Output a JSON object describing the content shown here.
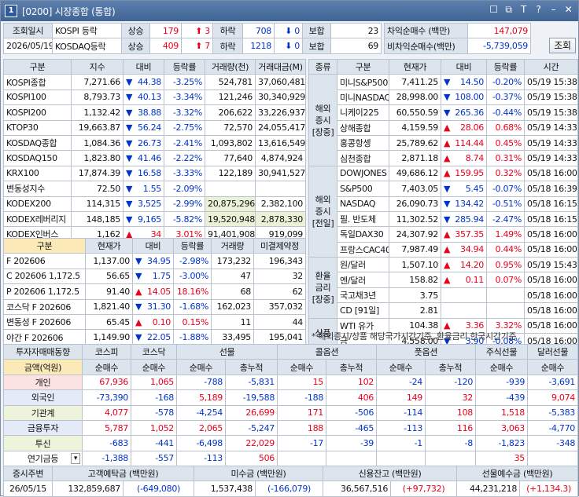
{
  "window": {
    "num": "1",
    "title": "[0200] 시장종합 (통합)",
    "btns": [
      "☐",
      "⧉",
      "T",
      "?",
      "–",
      "✕"
    ]
  },
  "top": {
    "inq_label": "조회일시",
    "date": "2026/05/19",
    "kospi": {
      "name": "KOSPI 등락",
      "up_lbl": "상승",
      "up": "179",
      "up_chg": "3",
      "dn_lbl": "하락",
      "dn": "708",
      "dn_chg": "0",
      "flat_lbl": "보합",
      "flat": "23"
    },
    "kosdaq": {
      "name": "KOSDAQ등락",
      "up_lbl": "상승",
      "up": "409",
      "up_chg": "7",
      "dn_lbl": "하락",
      "dn": "1218",
      "dn_chg": "0",
      "flat_lbl": "보합",
      "flat": "69"
    },
    "arb_label": "차익순매수",
    "arb_unit": "(백만)",
    "arb": "147,079",
    "narb_label": "비차익순매수",
    "narb_unit": "(백만)",
    "narb": "-5,739,059",
    "query_btn": "조회"
  },
  "index": {
    "headers": [
      "구분",
      "지수",
      "대비",
      "등락률",
      "거래량(천)",
      "거래대금(M)"
    ],
    "rows": [
      [
        "KOSPI종합",
        "7,271.66",
        "44.38",
        "-3.25%",
        "524,781",
        "37,060,481",
        "dn"
      ],
      [
        "KOSPI100",
        "8,793.73",
        "40.13",
        "-3.34%",
        "121,246",
        "30,340,929",
        "dn"
      ],
      [
        "KOSPI200",
        "1,132.42",
        "38.88",
        "-3.32%",
        "206,622",
        "33,226,937",
        "dn"
      ],
      [
        "KTOP30",
        "19,663.87",
        "56.24",
        "-2.75%",
        "72,570",
        "24,055,417",
        "dn"
      ],
      [
        "KOSDAQ종합",
        "1,084.36",
        "26.73",
        "-2.41%",
        "1,093,802",
        "13,616,549",
        "dn"
      ],
      [
        "KOSDAQ150",
        "1,823.80",
        "41.46",
        "-2.22%",
        "77,640",
        "4,874,924",
        "dn"
      ],
      [
        "KRX100",
        "17,874.39",
        "16.58",
        "-3.33%",
        "122,189",
        "30,941,527",
        "dn"
      ],
      [
        "변동성지수",
        "72.50",
        "1.55",
        "-2.09%",
        "",
        "",
        "dn"
      ],
      [
        "KODEX200",
        "114,315",
        "3,525",
        "-2.99%",
        "20,875,296",
        "2,382,100",
        "dn"
      ],
      [
        "KODEX레버리지",
        "148,185",
        "9,165",
        "-5.82%",
        "19,520,948",
        "2,878,330",
        "dn"
      ],
      [
        "KODEX인버스",
        "1,162",
        "34",
        "3.01%",
        "91,401,908",
        "919,099",
        "up"
      ]
    ]
  },
  "futures": {
    "headers": [
      "구분",
      "현재가",
      "대비",
      "등락률",
      "거래량",
      "미결제약정"
    ],
    "rows": [
      [
        "F 202606",
        "1,137.00",
        "34.95",
        "-2.98%",
        "173,232",
        "196,343",
        "dn"
      ],
      [
        "C 202606 1,172.5",
        "56.65",
        "1.75",
        "-3.00%",
        "47",
        "32",
        "dn"
      ],
      [
        "P 202606 1,172.5",
        "91.40",
        "14.05",
        "18.16%",
        "68",
        "62",
        "up"
      ],
      [
        "코스닥 F 202606",
        "1,821.40",
        "31.30",
        "-1.68%",
        "162,023",
        "357,032",
        "dn"
      ],
      [
        "변동성 F 202606",
        "65.45",
        "0.10",
        "0.15%",
        "11",
        "44",
        "up"
      ],
      [
        "야간 F 202606",
        "1,149.90",
        "22.05",
        "-1.88%",
        "33,495",
        "195,041",
        "dn"
      ]
    ]
  },
  "global": {
    "headers": [
      "종류",
      "구분",
      "현재가",
      "대비",
      "등락률",
      "시간"
    ],
    "groups": [
      {
        "label": "해외\n증시\n[장중]",
        "rows": [
          [
            "미니S&P500",
            "7,411.25",
            "14.50",
            "-0.20%",
            "05/19 15:38",
            "dn"
          ],
          [
            "미니NASDAQ",
            "28,998.00",
            "108.00",
            "-0.37%",
            "05/19 15:38",
            "dn"
          ],
          [
            "니케이225",
            "60,550.59",
            "265.36",
            "-0.44%",
            "05/19 15:38",
            "dn"
          ],
          [
            "상해종합",
            "4,159.59",
            "28.06",
            "0.68%",
            "05/19 14:33",
            "up"
          ],
          [
            "홍콩항셍",
            "25,789.62",
            "114.44",
            "0.45%",
            "05/19 14:33",
            "up"
          ],
          [
            "심천종합",
            "2,871.18",
            "8.74",
            "0.31%",
            "05/19 14:33",
            "up"
          ]
        ]
      },
      {
        "label": "해외\n증시\n[전일]",
        "rows": [
          [
            "DOWJONES",
            "49,686.12",
            "159.95",
            "0.32%",
            "05/18 16:00",
            "up"
          ],
          [
            "S&P500",
            "7,403.05",
            "5.45",
            "-0.07%",
            "05/18 16:39",
            "dn"
          ],
          [
            "NASDAQ",
            "26,090.73",
            "134.42",
            "-0.51%",
            "05/18 16:15",
            "dn"
          ],
          [
            "필. 반도체",
            "11,302.52",
            "285.94",
            "-2.47%",
            "05/18 16:15",
            "dn"
          ],
          [
            "독일DAX30",
            "24,307.92",
            "357.35",
            "1.49%",
            "05/18 16:00",
            "up"
          ],
          [
            "프랑스CAC40",
            "7,987.49",
            "34.94",
            "0.44%",
            "05/18 16:00",
            "up"
          ]
        ]
      },
      {
        "label": "환율\n금리\n[장중]",
        "rows": [
          [
            "원/달러",
            "1,507.10",
            "14.20",
            "0.95%",
            "05/19 15:43",
            "up"
          ],
          [
            "엔/달러",
            "158.82",
            "0.11",
            "0.07%",
            "05/18 16:00",
            "up"
          ],
          [
            "국고채3년",
            "3.75",
            "",
            "",
            "05/18 16:00",
            ""
          ],
          [
            "CD [91일]",
            "2.81",
            "",
            "",
            "05/18 16:00",
            ""
          ]
        ]
      },
      {
        "label": "상품",
        "rows": [
          [
            "WTI 유가",
            "104.38",
            "3.36",
            "3.32%",
            "05/18 16:00",
            "up"
          ],
          [
            "금",
            "4,558.00",
            "3.90",
            "-0.08%",
            "05/18 16:00",
            "dn"
          ]
        ]
      }
    ],
    "note": "* 해외증시/상품 해당국가시간기준, 환율금리 한국시간기준"
  },
  "investor": {
    "h1": [
      "투자자매매동향",
      "코스피",
      "코스닥",
      "선물",
      "",
      "콜옵션",
      "",
      "풋옵션",
      "",
      "주식선물",
      "달러선물"
    ],
    "h2": [
      "금액(억원)",
      "순매수",
      "순매수",
      "순매수",
      "총누적",
      "순매수",
      "총누적",
      "순매수",
      "총누적",
      "순매수",
      "순매수"
    ],
    "rows": [
      [
        "개인",
        "67,936",
        "1,065",
        "-788",
        "-5,831",
        "15",
        "102",
        "-24",
        "-120",
        "-939",
        "-3,691"
      ],
      [
        "외국인",
        "-73,390",
        "-168",
        "5,189",
        "-19,588",
        "-188",
        "406",
        "149",
        "32",
        "-439",
        "9,074"
      ],
      [
        "기관계",
        "4,077",
        "-578",
        "-4,254",
        "26,699",
        "171",
        "-506",
        "-114",
        "108",
        "1,518",
        "-5,383"
      ],
      [
        "금융투자",
        "5,787",
        "1,052",
        "2,065",
        "-5,247",
        "188",
        "-465",
        "-113",
        "116",
        "3,063",
        "-4,770"
      ],
      [
        "투신",
        "-683",
        "-441",
        "-6,498",
        "22,029",
        "-17",
        "-39",
        "-1",
        "-8",
        "-1,823",
        "-348"
      ],
      [
        "연기금등",
        "-1,388",
        "-557",
        "-113",
        "506",
        "",
        "",
        "",
        "",
        "35",
        ""
      ]
    ]
  },
  "bottom": {
    "labels": [
      "증시주변",
      "고객예탁금 (백만원)",
      "미수금 (백만원)",
      "신용잔고 (백만원)",
      "선물예수금 (백만원)"
    ],
    "date": "26/05/15",
    "deposit": "132,859,687",
    "deposit_chg": "-649,080",
    "unpaid": "1,537,438",
    "unpaid_chg": "-166,079",
    "credit": "36,567,516",
    "credit_chg": "+97,732",
    "fut_dep": "44,231,218",
    "fut_dep_chg": "+1,134.3"
  }
}
